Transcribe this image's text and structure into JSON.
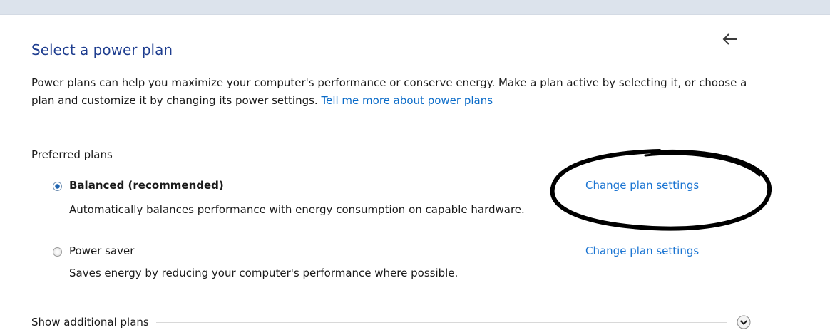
{
  "page": {
    "title": "Select a power plan",
    "description_text": "Power plans can help you maximize your computer's performance or conserve energy. Make a plan active by selecting it, or choose a plan and customize it by changing its power settings.",
    "description_link": "Tell me more about power plans"
  },
  "icons": {
    "back": "back-arrow-icon",
    "expand": "chevron-down-circle-icon",
    "radio_checked": "radio-checked-icon",
    "radio_unchecked": "radio-unchecked-icon"
  },
  "preferred": {
    "header": "Preferred plans",
    "plans": [
      {
        "name": "Balanced (recommended)",
        "description": "Automatically balances performance with energy consumption on capable hardware.",
        "link": "Change plan settings",
        "selected": true
      },
      {
        "name": "Power saver",
        "description": "Saves energy by reducing your computer's performance where possible.",
        "link": "Change plan settings",
        "selected": false
      }
    ]
  },
  "additional": {
    "header": "Show additional plans"
  },
  "colors": {
    "title": "#1e3d8f",
    "link": "#1a74d2",
    "annotation_ink": "#000000"
  }
}
